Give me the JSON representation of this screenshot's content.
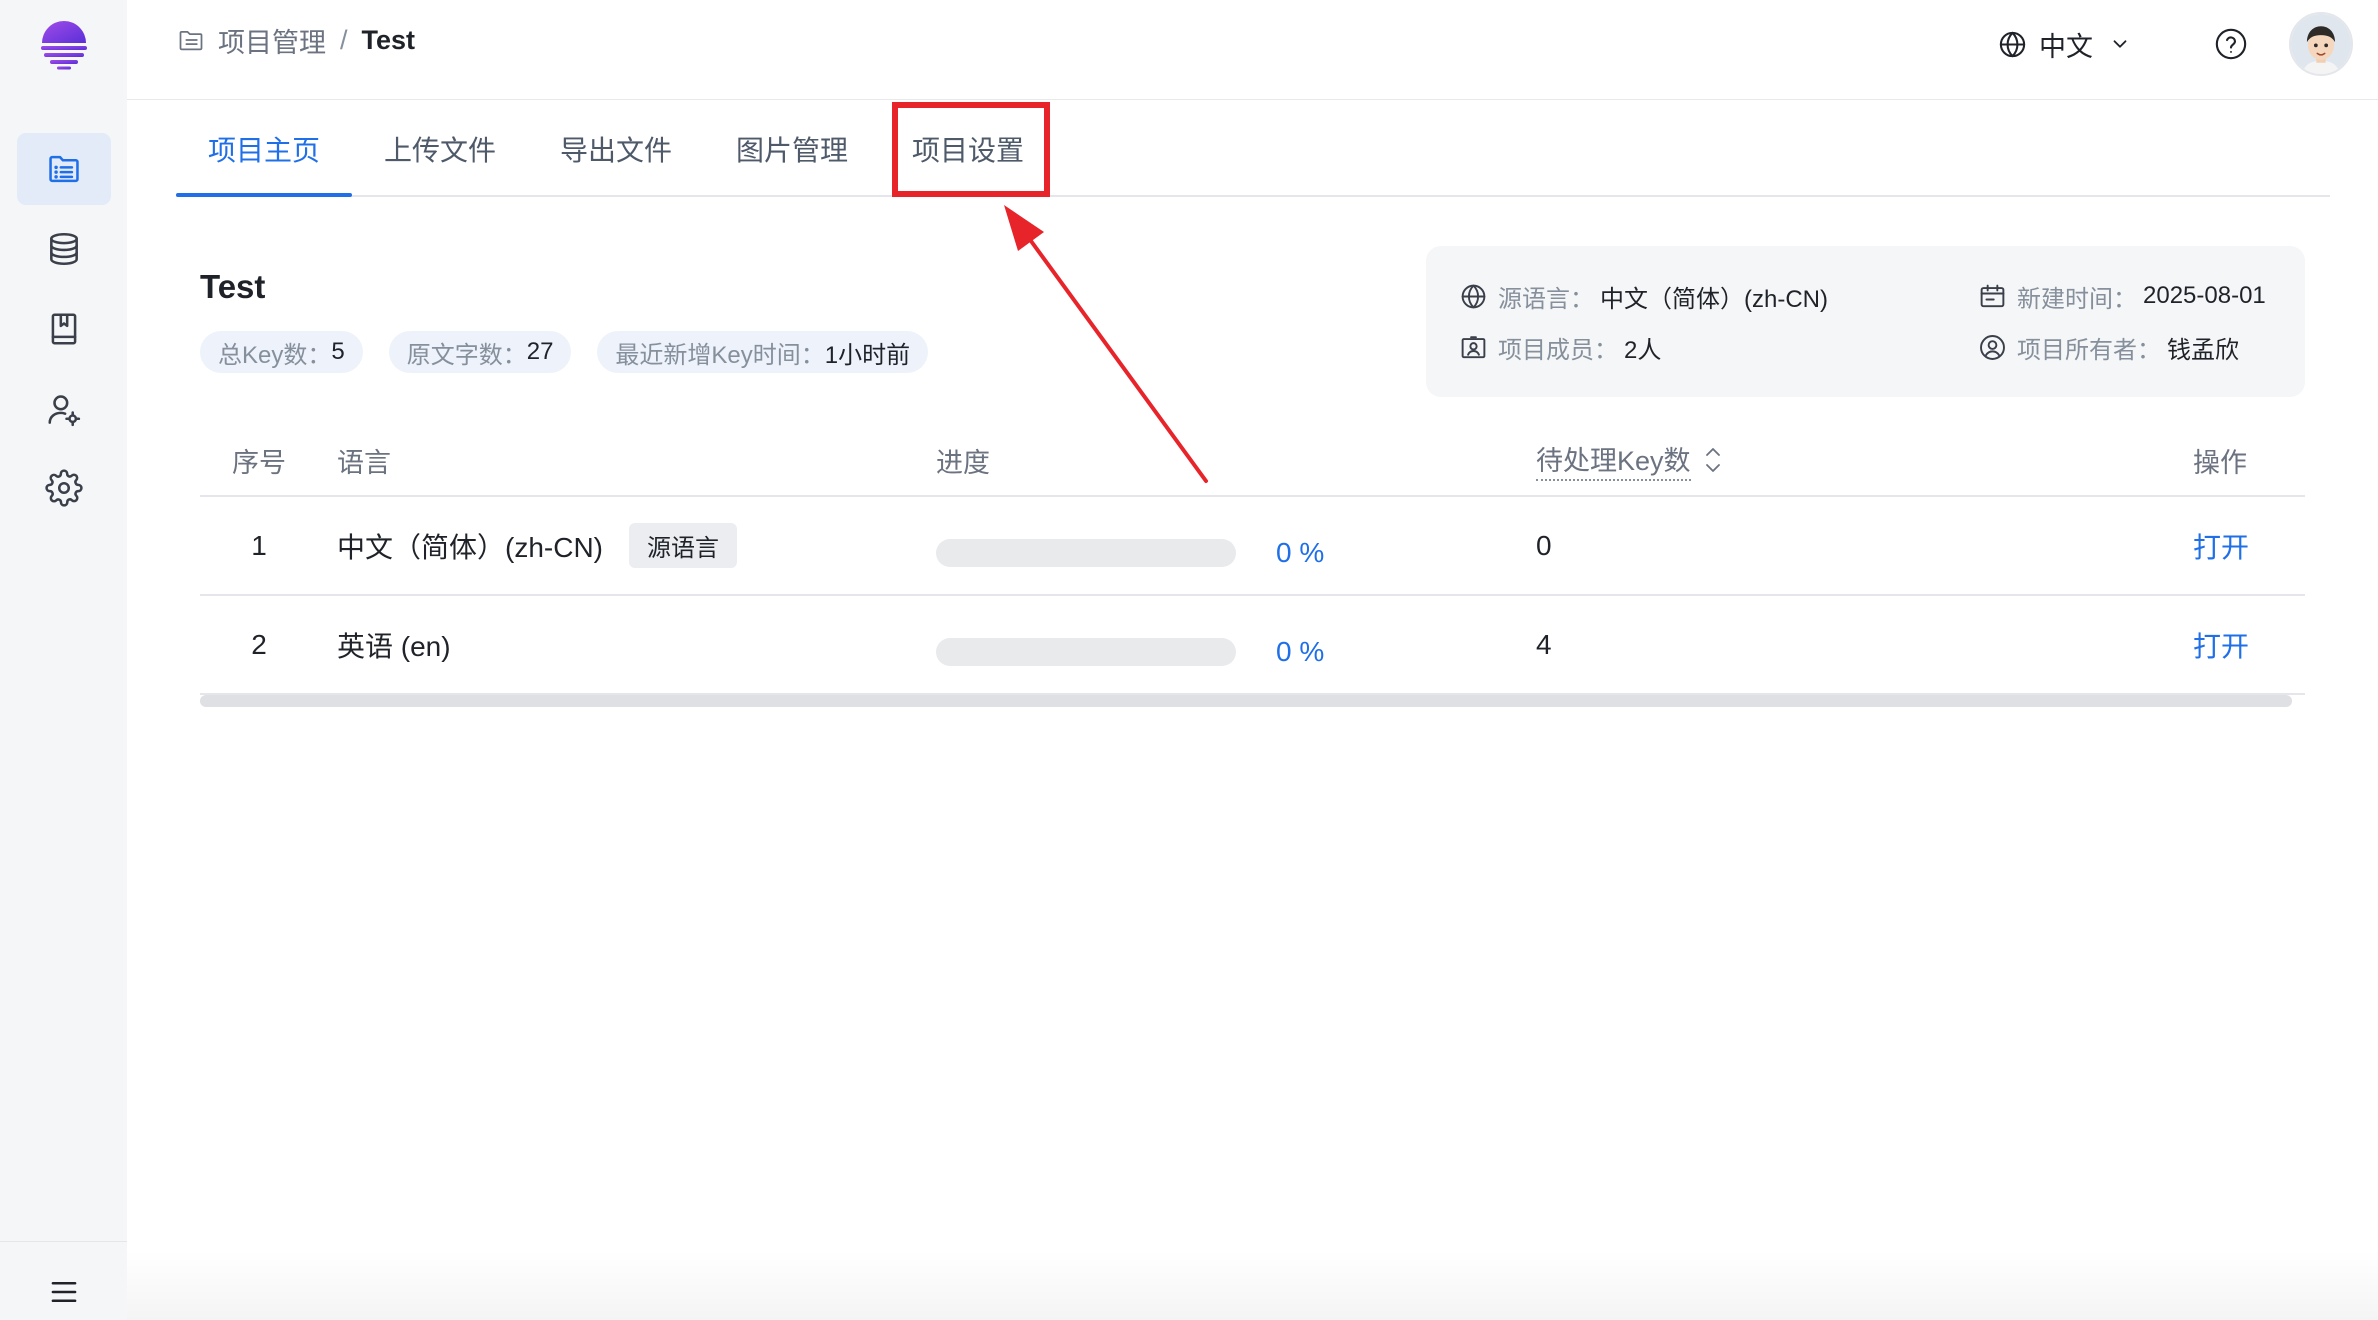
{
  "app": {
    "logo_icon": "app-logo-icon"
  },
  "sidebar": {
    "items": [
      {
        "icon": "file-list-icon",
        "active": true
      },
      {
        "icon": "database-icon",
        "active": false
      },
      {
        "icon": "book-icon",
        "active": false
      },
      {
        "icon": "user-settings-icon",
        "active": false
      },
      {
        "icon": "gear-icon",
        "active": false
      }
    ],
    "collapse_icon": "menu-icon"
  },
  "header": {
    "breadcrumb_icon": "folder-icon",
    "breadcrumb": [
      "项目管理",
      "Test"
    ],
    "breadcrumb_separator": "/",
    "language_icon": "globe-icon",
    "language": "中文",
    "language_chevron_icon": "chevron-down-icon",
    "help_icon": "help-icon",
    "avatar_icon": "user-avatar"
  },
  "tabs": [
    {
      "label": "项目主页",
      "active": true
    },
    {
      "label": "上传文件",
      "active": false
    },
    {
      "label": "导出文件",
      "active": false
    },
    {
      "label": "图片管理",
      "active": false
    },
    {
      "label": "项目设置",
      "active": false
    }
  ],
  "project": {
    "title": "Test",
    "stats": [
      {
        "label": "总Key数：",
        "value": "5"
      },
      {
        "label": "原文字数：",
        "value": "27"
      },
      {
        "label": "最近新增Key时间：",
        "value": "1小时前"
      }
    ]
  },
  "info": {
    "source_language": {
      "icon": "globe-icon",
      "label": "源语言：",
      "value": "中文（简体）(zh-CN)"
    },
    "created_at": {
      "icon": "calendar-icon",
      "label": "新建时间：",
      "value": "2025-08-01"
    },
    "members": {
      "icon": "id-card-icon",
      "label": "项目成员：",
      "value": "2人"
    },
    "owner": {
      "icon": "user-circle-icon",
      "label": "项目所有者：",
      "value": "钱孟欣"
    }
  },
  "table": {
    "columns": [
      "序号",
      "语言",
      "进度",
      "待处理Key数",
      "操作"
    ],
    "sort_icon": "sort-icon",
    "rows": [
      {
        "index": "1",
        "language": "中文（简体）(zh-CN)",
        "tag": "源语言",
        "progress": 0,
        "progress_label": "0 %",
        "pending_keys": "0",
        "action": "打开"
      },
      {
        "index": "2",
        "language": "英语 (en)",
        "progress": 0,
        "progress_label": "0 %",
        "pending_keys": "4",
        "action": "打开"
      }
    ]
  },
  "colors": {
    "primary": "#1f6fe8",
    "text": "#1f2329",
    "muted": "#86909c",
    "secondary_text": "#4e5969",
    "header_text": "#6b7280",
    "sidebar_bg": "#f5f6f8",
    "sidebar_active_bg": "#e3ebf8",
    "stat_bg": "#edf2fb",
    "card_bg": "#f5f6f7",
    "tag_bg": "#ebedf0",
    "progress_track": "#e9eaec",
    "border": "#e5e6eb",
    "brand_start": "#a24ce8",
    "brand_end": "#5a2fd8",
    "annotation": "#e8242b"
  }
}
